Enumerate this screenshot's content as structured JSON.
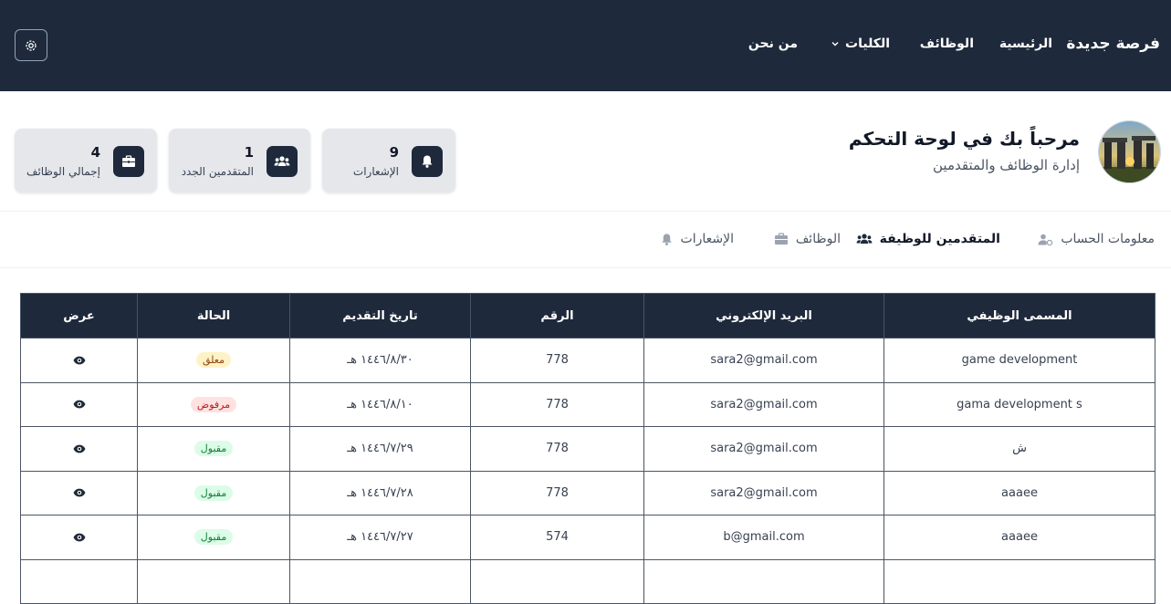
{
  "header": {
    "brand": "فرصة جديدة",
    "nav": {
      "home": "الرئيسية",
      "jobs": "الوظائف",
      "colleges": "الكليات",
      "about": "من نحن"
    }
  },
  "welcome": {
    "title": "مرحباً بك في لوحة التحكم",
    "subtitle": "إدارة الوظائف والمتقدمين"
  },
  "stats": {
    "notifications": {
      "value": "9",
      "label": "الإشعارات"
    },
    "new_applicants": {
      "value": "1",
      "label": "المتقدمين الجدد"
    },
    "total_jobs": {
      "value": "4",
      "label": "إجمالي الوظائف"
    }
  },
  "tabs": {
    "account": "معلومات الحساب",
    "applicants": "المتقدمين للوظيفة",
    "jobs": "الوظائف",
    "notifications": "الإشعارات"
  },
  "table": {
    "headers": {
      "job_title": "المسمى الوظيفي",
      "email": "البريد الإلكتروني",
      "number": "الرقم",
      "date": "تاريخ التقديم",
      "status": "الحالة",
      "view": "عرض"
    },
    "rows": [
      {
        "job_title": "game development",
        "email": "sara2@gmail.com",
        "number": "778",
        "date": "١٤٤٦/٨/٣٠ هـ",
        "status": "معلق"
      },
      {
        "job_title": "gama development s",
        "email": "sara2@gmail.com",
        "number": "778",
        "date": "١٤٤٦/٨/١٠ هـ",
        "status": "مرفوض"
      },
      {
        "job_title": "ش",
        "email": "sara2@gmail.com",
        "number": "778",
        "date": "١٤٤٦/٧/٢٩ هـ",
        "status": "مقبول"
      },
      {
        "job_title": "aaaee",
        "email": "sara2@gmail.com",
        "number": "778",
        "date": "١٤٤٦/٧/٢٨ هـ",
        "status": "مقبول"
      },
      {
        "job_title": "aaaee",
        "email": "b@gmail.com",
        "number": "574",
        "date": "١٤٤٦/٧/٢٧ هـ",
        "status": "مقبول"
      }
    ]
  },
  "colors": {
    "header_bg": "#1e293b",
    "status_pending_bg": "#fef3c7",
    "status_pending_fg": "#92400e",
    "status_rejected_bg": "#fee2e2",
    "status_rejected_fg": "#b91c1c",
    "status_accepted_bg": "#dcfce7",
    "status_accepted_fg": "#15803d"
  },
  "icons": {
    "settings": "gear-icon",
    "notifications": "bell-icon",
    "applicants": "users-icon",
    "jobs": "briefcase-icon",
    "account": "user-gear-icon",
    "view": "eye-icon"
  }
}
